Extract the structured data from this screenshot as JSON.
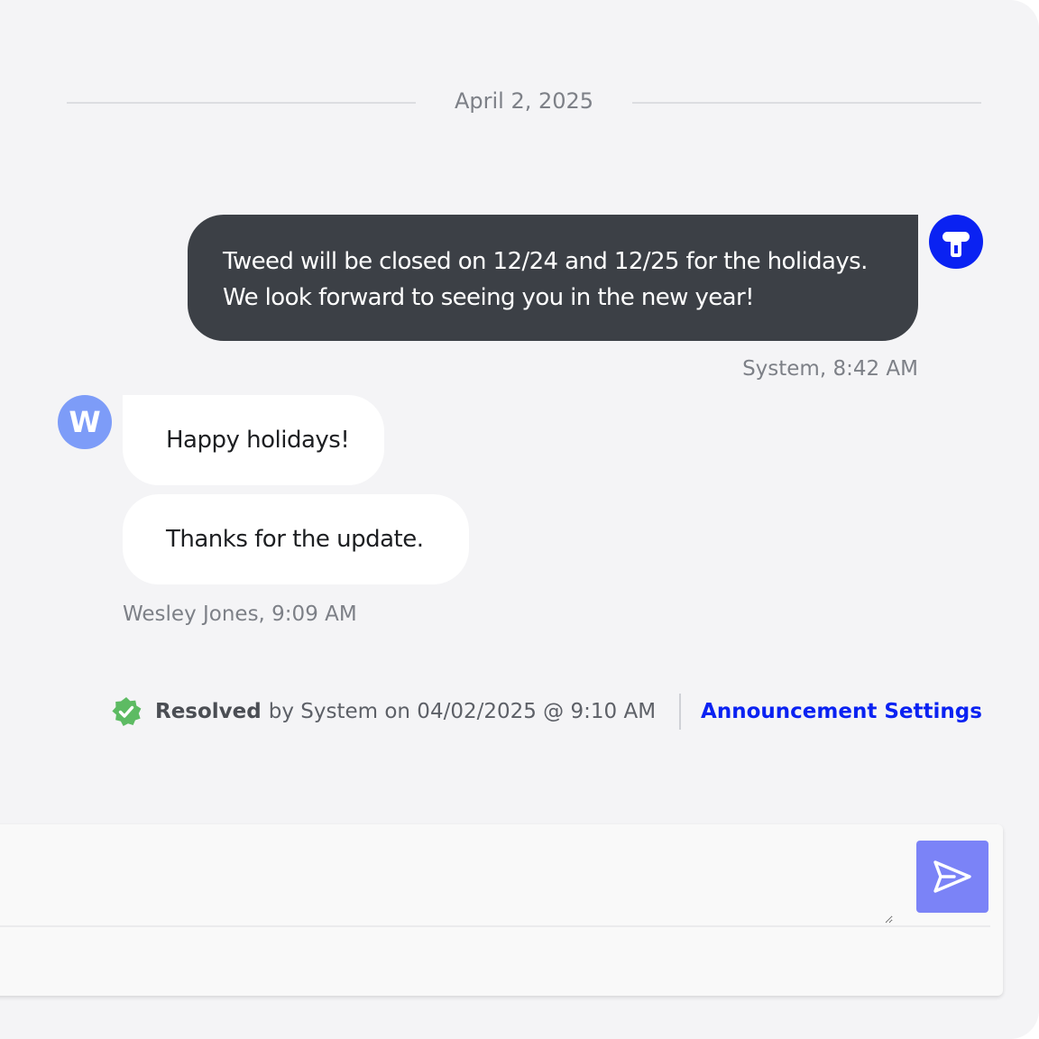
{
  "thread": {
    "date_label": "April 2, 2025"
  },
  "messages": {
    "system": {
      "line1": "Tweed will be closed on 12/24 and 12/25 for the holidays.",
      "line2": "We look forward to seeing you in the new year!",
      "meta": "System, 8:42 AM",
      "avatar_icon": "tweed-logo-icon"
    },
    "user": {
      "avatar_initial": "W",
      "message1": "Happy holidays!",
      "message2": "Thanks for the update.",
      "meta": "Wesley Jones, 9:09 AM"
    }
  },
  "status": {
    "icon": "verified-check-icon",
    "label": "Resolved",
    "detail": "by System on 04/02/2025 @ 9:10 AM",
    "link": "Announcement Settings"
  },
  "composer": {
    "placeholder": "",
    "send_icon": "send-icon"
  },
  "colors": {
    "background": "#f4f4f6",
    "system_bubble": "#3c4046",
    "brand_blue": "#0a22f2",
    "user_avatar": "#7d9cf8",
    "resolved_green": "#5dbb63",
    "send_button": "#7b83f7"
  }
}
